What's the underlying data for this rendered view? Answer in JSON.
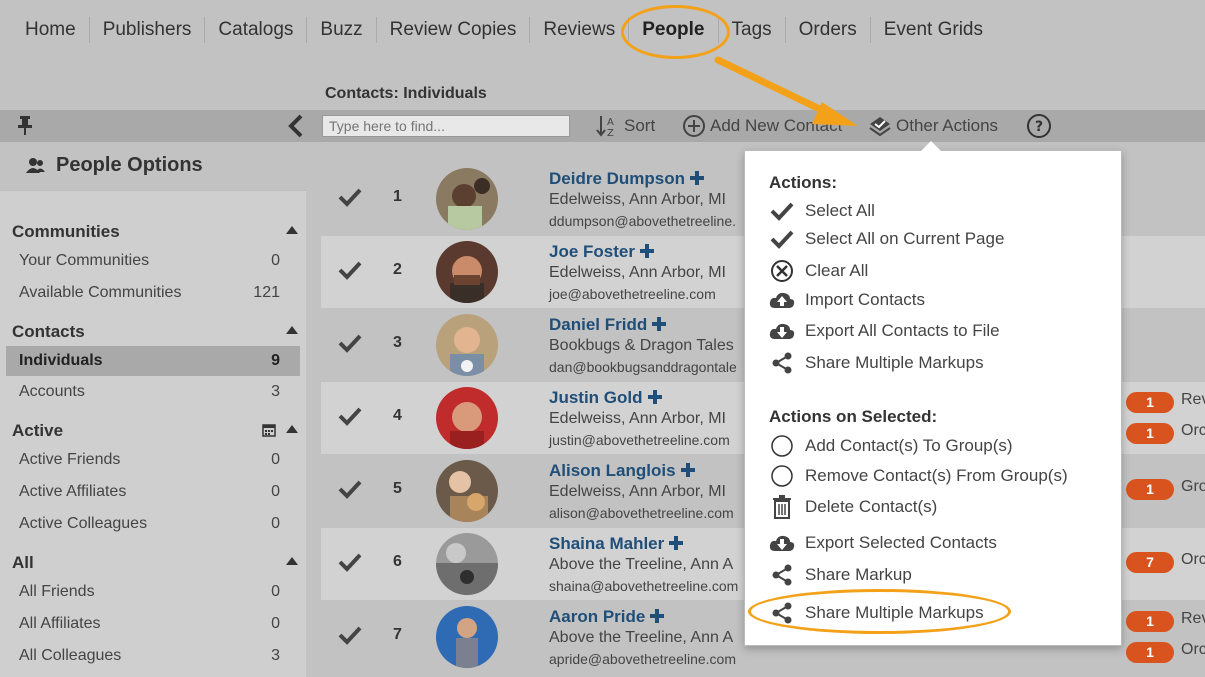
{
  "nav": [
    "Home",
    "Publishers",
    "Catalogs",
    "Buzz",
    "Review Copies",
    "Reviews",
    "People",
    "Tags",
    "Orders",
    "Event Grids"
  ],
  "section_title": "Contacts: Individuals",
  "toolbar": {
    "search_placeholder": "Type here to find...",
    "sort": "Sort",
    "add": "Add New Contact",
    "other": "Other Actions"
  },
  "sidebar": {
    "title": "People Options",
    "groups": {
      "communities": "Communities",
      "contacts": "Contacts",
      "active": "Active",
      "all": "All"
    },
    "items": [
      {
        "label": "Your Communities",
        "count": "0"
      },
      {
        "label": "Available Communities",
        "count": "121"
      },
      {
        "label": "Individuals",
        "count": "9"
      },
      {
        "label": "Accounts",
        "count": "3"
      },
      {
        "label": "Active Friends",
        "count": "0"
      },
      {
        "label": "Active Affiliates",
        "count": "0"
      },
      {
        "label": "Active Colleagues",
        "count": "0"
      },
      {
        "label": "All Friends",
        "count": "0"
      },
      {
        "label": "All Affiliates",
        "count": "0"
      },
      {
        "label": "All Colleagues",
        "count": "3"
      }
    ]
  },
  "contacts": [
    {
      "num": "1",
      "name": "Deidre Dumpson",
      "org": "Edelweiss, Ann Arbor, MI",
      "email": "ddumpson@abovethetreeline."
    },
    {
      "num": "2",
      "name": "Joe Foster",
      "org": "Edelweiss, Ann Arbor, MI",
      "email": "joe@abovethetreeline.com"
    },
    {
      "num": "3",
      "name": "Daniel Fridd",
      "org": "Bookbugs & Dragon Tales",
      "email": "dan@bookbugsanddragontale"
    },
    {
      "num": "4",
      "name": "Justin Gold",
      "org": "Edelweiss, Ann Arbor, MI",
      "email": "justin@abovethetreeline.com"
    },
    {
      "num": "5",
      "name": "Alison Langlois",
      "org": "Edelweiss, Ann Arbor, MI",
      "email": "alison@abovethetreeline.com"
    },
    {
      "num": "6",
      "name": "Shaina Mahler",
      "org": "Above the Treeline, Ann A",
      "email": "shaina@abovethetreeline.com"
    },
    {
      "num": "7",
      "name": "Aaron Pride",
      "org": "Above the Treeline, Ann A",
      "email": "apride@abovethetreeline.com"
    }
  ],
  "badges": [
    {
      "value": "1",
      "label": "Rev"
    },
    {
      "value": "1",
      "label": "Orc"
    },
    {
      "value": "1",
      "label": "Gro"
    },
    {
      "value": "7",
      "label": "Orc"
    },
    {
      "value": "1",
      "label": "Rev"
    },
    {
      "value": "1",
      "label": "Orc"
    }
  ],
  "menu": {
    "actions_head": "Actions:",
    "actions": [
      "Select All",
      "Select All on Current Page",
      "Clear All",
      "Import Contacts",
      "Export All Contacts to File",
      "Share Multiple Markups"
    ],
    "selected_head": "Actions on Selected:",
    "selected": [
      "Add Contact(s) To Group(s)",
      "Remove Contact(s) From Group(s)",
      "Delete Contact(s)",
      "Export Selected Contacts",
      "Share Markup",
      "Share Multiple Markups"
    ]
  },
  "colors": {
    "highlight": "#f4a11a",
    "badge": "#d9531e",
    "link": "#1f4e79"
  }
}
